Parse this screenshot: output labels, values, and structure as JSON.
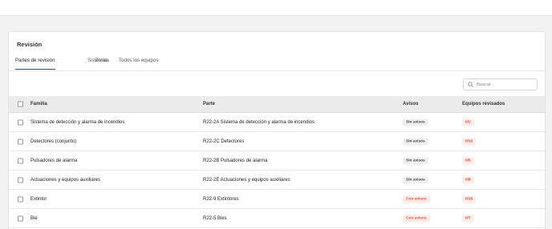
{
  "page": {
    "title": "Revisión",
    "tabs": [
      "Partes de revisión",
      "Sistemas",
      "Zonas",
      "Todos los equipos"
    ],
    "active_tab": 0
  },
  "search": {
    "placeholder": "Buscar",
    "value": ""
  },
  "table": {
    "columns": {
      "familia": "Familia",
      "parte": "Parte",
      "avisos": "Avisos",
      "equipos": "Equipos revisados"
    },
    "rows": [
      {
        "familia": "Sistema de detección y alarma de incendios",
        "parte": "R22-2A Sistema de detección y alarma de incendios",
        "avisos": "Sin avisos",
        "avisos_state": "none",
        "equipos": "0/2"
      },
      {
        "familia": "Detectores (conjunto)",
        "parte": "R22-2C Detectores",
        "avisos": "Sin avisos",
        "avisos_state": "none",
        "equipos": "0/10"
      },
      {
        "familia": "Pulsadores de alarma",
        "parte": "R22-2B Pulsadores de alarma",
        "avisos": "Sin avisos",
        "avisos_state": "none",
        "equipos": "0/5"
      },
      {
        "familia": "Actuaciones y equipos auxiliares",
        "parte": "R22-2E Actuaciones y equipos auxiliares",
        "avisos": "Sin avisos",
        "avisos_state": "none",
        "equipos": "0/8"
      },
      {
        "familia": "Extintor",
        "parte": "R22-9 Extintores",
        "avisos": "Con avisos",
        "avisos_state": "warn",
        "equipos": "0/15"
      },
      {
        "familia": "Bie",
        "parte": "R22-5 Bies",
        "avisos": "Con avisos",
        "avisos_state": "warn",
        "equipos": "0/7"
      }
    ]
  },
  "colors": {
    "accent": "#1a4f8c",
    "badge_neutral_bg": "#efefef",
    "badge_warn_bg": "#fde9e6",
    "badge_warn_text": "#e25a3c",
    "count_bg": "#fdecea",
    "count_text": "#d64a33",
    "header_bg": "#ebebeb"
  },
  "icons": {
    "search": "search-icon",
    "checkbox": "checkbox-icon"
  }
}
